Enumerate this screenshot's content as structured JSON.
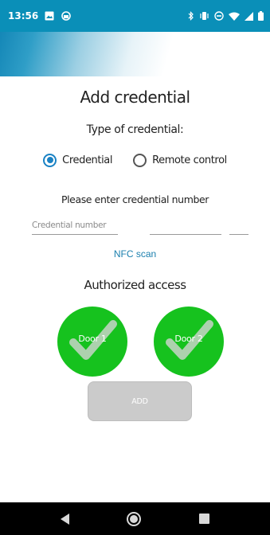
{
  "status_bar": {
    "time": "13:56",
    "left_icons": [
      "image-icon",
      "cloud-sync-icon"
    ],
    "right_icons": [
      "bluetooth-icon",
      "vibrate-icon",
      "do-not-disturb-icon",
      "wifi-icon",
      "signal-icon",
      "battery-icon"
    ]
  },
  "page": {
    "title": "Add credential",
    "type_label": "Type of credential:",
    "type_options": [
      {
        "label": "Credential",
        "selected": true
      },
      {
        "label": "Remote control",
        "selected": false
      }
    ],
    "prompt": "Please enter credential number",
    "credential_input": {
      "placeholder": "Credential number",
      "value": ""
    },
    "nfc_link": "NFC scan",
    "access_title": "Authorized access",
    "doors": [
      {
        "label": "Door 1",
        "checked": true
      },
      {
        "label": "Door 2",
        "checked": true
      }
    ],
    "add_button": "ADD"
  },
  "colors": {
    "status_bar": "#0a8fb8",
    "accent": "#1a82c4",
    "door_green": "#16c21e",
    "button_disabled": "#cbcbcb",
    "link": "#1a7fae"
  }
}
